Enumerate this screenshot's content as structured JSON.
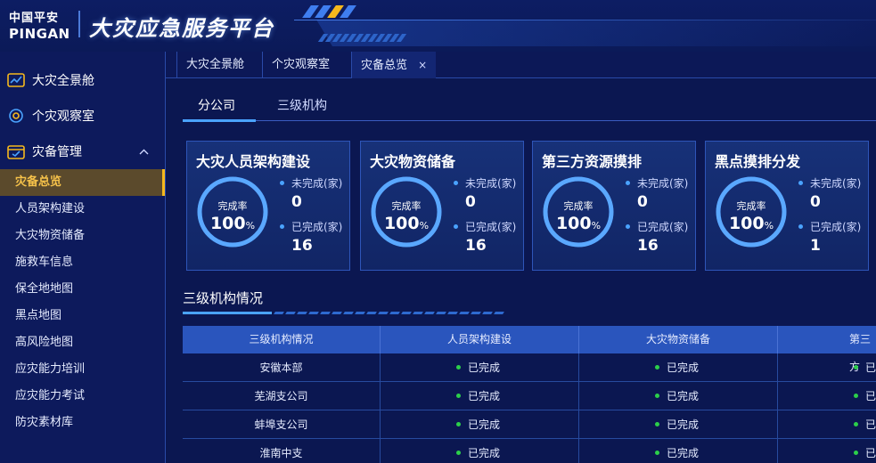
{
  "header": {
    "logo_cn": "中国平安",
    "logo_en": "PINGAN",
    "title": "大灾应急服务平台"
  },
  "sidebar": {
    "items": [
      {
        "label": "大灾全景舱",
        "icon": "dashboard-chart-icon"
      },
      {
        "label": "个灾观察室",
        "icon": "target-gear-icon"
      },
      {
        "label": "灾备管理",
        "icon": "calendar-check-icon",
        "expanded": true
      }
    ],
    "sub_items": [
      {
        "label": "灾备总览",
        "active": true
      },
      {
        "label": "人员架构建设"
      },
      {
        "label": "大灾物资储备"
      },
      {
        "label": "施救车信息"
      },
      {
        "label": "保全地地图"
      },
      {
        "label": "黑点地图"
      },
      {
        "label": "高风险地图"
      },
      {
        "label": "应灾能力培训"
      },
      {
        "label": "应灾能力考试"
      },
      {
        "label": "防灾素材库"
      }
    ]
  },
  "tabs": [
    {
      "label": "大灾全景舱"
    },
    {
      "label": "个灾观察室"
    },
    {
      "label": "灾备总览",
      "active": true,
      "closable": true,
      "close_glyph": "×"
    }
  ],
  "subtabs": [
    {
      "label": "分公司",
      "active": true
    },
    {
      "label": "三级机构"
    }
  ],
  "cards": [
    {
      "title": "大灾人员架构建设",
      "rate_label": "完成率",
      "rate_value": "100",
      "rate_unit": "%",
      "rate": 1.0,
      "undone_label": "未完成(家)",
      "undone": "0",
      "done_label": "已完成(家)",
      "done": "16"
    },
    {
      "title": "大灾物资储备",
      "rate_label": "完成率",
      "rate_value": "100",
      "rate_unit": "%",
      "rate": 1.0,
      "undone_label": "未完成(家)",
      "undone": "0",
      "done_label": "已完成(家)",
      "done": "16"
    },
    {
      "title": "第三方资源摸排",
      "rate_label": "完成率",
      "rate_value": "100",
      "rate_unit": "%",
      "rate": 1.0,
      "undone_label": "未完成(家)",
      "undone": "0",
      "done_label": "已完成(家)",
      "done": "16"
    },
    {
      "title": "黑点摸排分发",
      "rate_label": "完成率",
      "rate_value": "100",
      "rate_unit": "%",
      "rate": 1.0,
      "undone_label": "未完成(家)",
      "undone": "0",
      "done_label": "已完成(家)",
      "done": "1"
    }
  ],
  "section": {
    "title": "三级机构情况"
  },
  "table": {
    "headers": [
      "三级机构情况",
      "人员架构建设",
      "大灾物资储备",
      "第三方"
    ],
    "rows": [
      {
        "name": "安徽本部",
        "cells": [
          "已完成",
          "已完成",
          "已"
        ]
      },
      {
        "name": "芜湖支公司",
        "cells": [
          "已完成",
          "已完成",
          "已"
        ]
      },
      {
        "name": "蚌埠支公司",
        "cells": [
          "已完成",
          "已完成",
          "已"
        ]
      },
      {
        "name": "淮南中支",
        "cells": [
          "已完成",
          "已完成",
          "已"
        ]
      }
    ]
  },
  "colors": {
    "accent": "#4aa3ff",
    "active_menu": "#f5b81d",
    "status_done": "#2ccf4a",
    "background": "#0a1650"
  }
}
